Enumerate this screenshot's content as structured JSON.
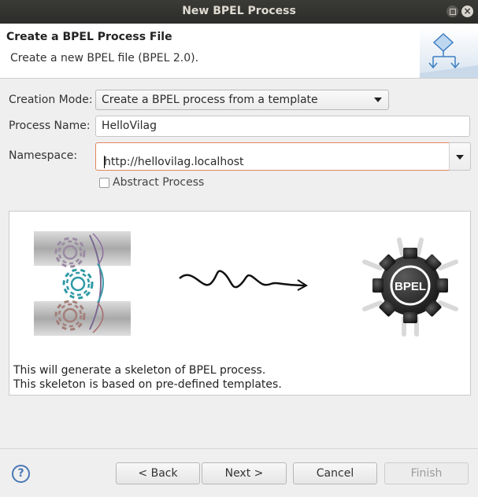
{
  "window": {
    "title": "New BPEL Process"
  },
  "header": {
    "title": "Create a BPEL Process File",
    "description": "Create a new BPEL file (BPEL 2.0).",
    "icon": "bpel-wizard-icon"
  },
  "form": {
    "creation_mode_label": "Creation Mode:",
    "creation_mode_value": "Create a BPEL process from a template",
    "process_name_label": "Process Name:",
    "process_name_value": "HelloVilag",
    "namespace_label": "Namespace:",
    "namespace_value": "http://hellovilag.localhost",
    "abstract_label": "Abstract Process",
    "abstract_checked": false
  },
  "preview": {
    "engine_label": "BPEL",
    "line1": "This will generate a skeleton of BPEL process.",
    "line2": "This skeleton is based on pre-defined templates."
  },
  "buttons": {
    "help": "?",
    "back": "< Back",
    "next": "Next >",
    "cancel": "Cancel",
    "finish": "Finish"
  },
  "colors": {
    "titlebar": "#2f2f2d",
    "focus_border": "#e0855c",
    "gear_teal": "#2e9aa5",
    "help_blue": "#4a78b5"
  }
}
